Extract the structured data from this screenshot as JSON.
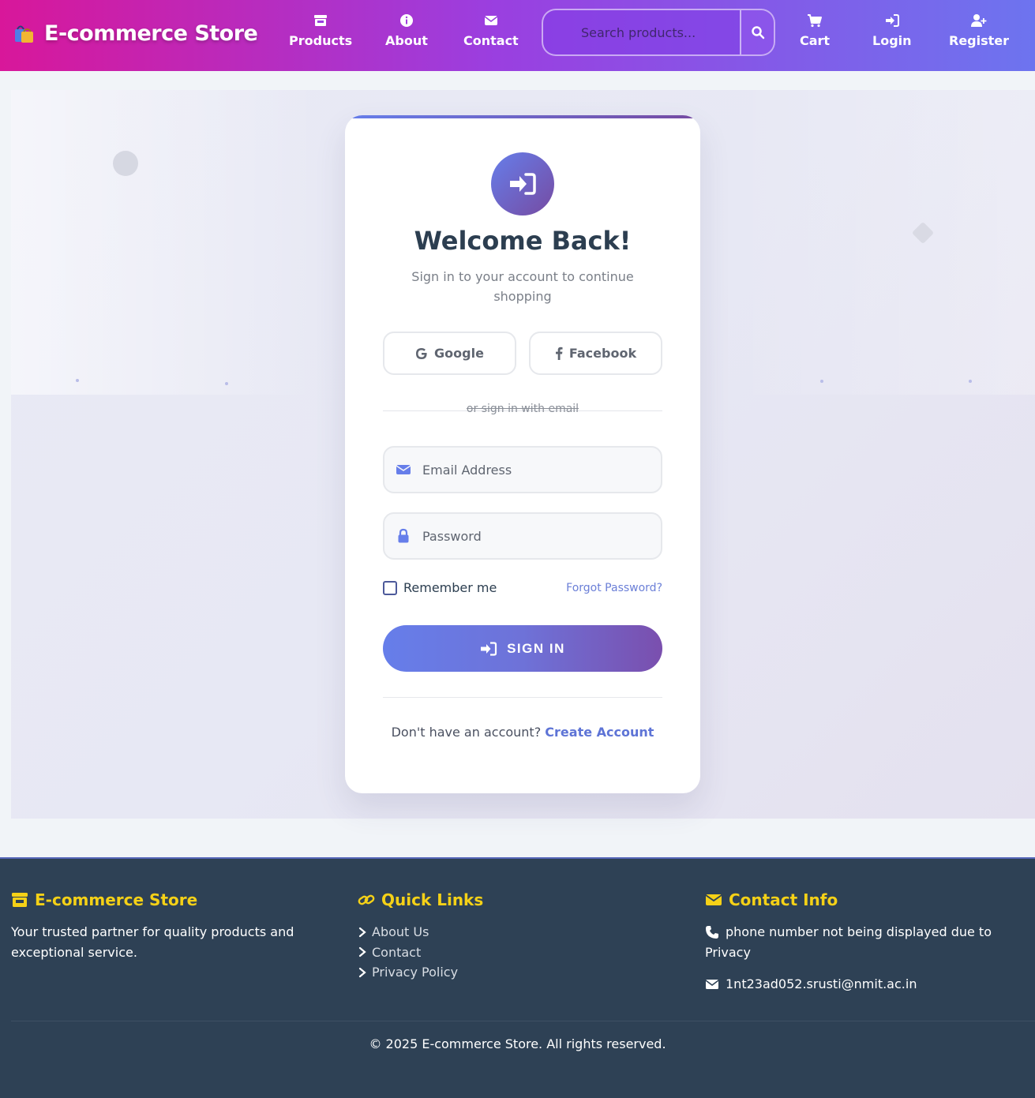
{
  "navbar": {
    "brand": "E-commerce Store",
    "items": [
      {
        "label": "Products",
        "icon": "store-icon"
      },
      {
        "label": "About",
        "icon": "info-icon"
      },
      {
        "label": "Contact",
        "icon": "envelope-icon"
      },
      {
        "label": "Cart",
        "icon": "cart-icon"
      },
      {
        "label": "Login",
        "icon": "sign-in-icon"
      },
      {
        "label": "Register",
        "icon": "user-plus-icon"
      }
    ],
    "search_placeholder": "Search products..."
  },
  "login_card": {
    "title": "Welcome Back!",
    "subtitle": "Sign in to your account to continue shopping",
    "social": {
      "google": "Google",
      "facebook": "Facebook"
    },
    "divider": "or sign in with email",
    "email_placeholder": "Email Address",
    "password_placeholder": "Password",
    "remember": "Remember me",
    "forgot": "Forgot Password?",
    "submit": "SIGN IN",
    "register_prompt": "Don't have an account?",
    "register_link": "Create Account"
  },
  "footer": {
    "brand": {
      "title": "E-commerce Store",
      "text": "Your trusted partner for quality products and exceptional service."
    },
    "quick_links": {
      "title": "Quick Links",
      "items": [
        "About Us",
        "Contact",
        "Privacy Policy"
      ]
    },
    "contact": {
      "title": "Contact Info",
      "phone": "phone number not being displayed due to Privacy",
      "email": "1nt23ad052.srusti@nmit.ac.in"
    },
    "copyright": "© 2025 E-commerce Store. All rights reserved."
  },
  "colors": {
    "nav_gradient_start": "#d8179a",
    "nav_gradient_end": "#6d74ef",
    "accent": "#667eea",
    "accent_dark": "#764ba2",
    "footer_bg": "#2e4155",
    "footer_heading": "#f5d117"
  }
}
